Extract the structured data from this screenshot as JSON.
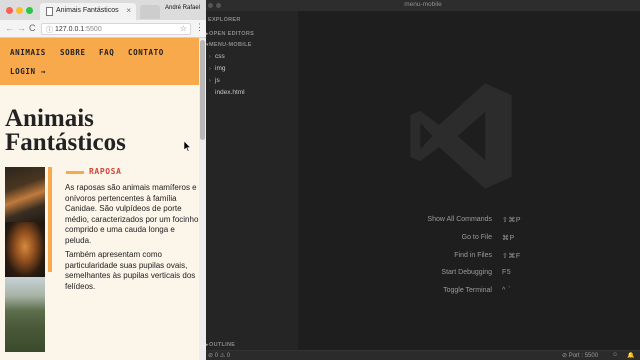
{
  "browser": {
    "tab_title": "Animais Fantásticos",
    "tab_close": "×",
    "profile_name": "André Rafael",
    "url_host": "127.0.0.1",
    "url_port": ":5500",
    "info_icon": "ⓘ",
    "back_icon": "←",
    "forward_icon": "→",
    "reload_icon": "C",
    "star_icon": "☆",
    "menu_icon": "⋮"
  },
  "site": {
    "nav": {
      "animais": "ANIMAIS",
      "sobre": "SOBRE",
      "faq": "FAQ",
      "contato": "CONTATO",
      "login": "LOGIN →"
    },
    "title": "Animais Fantásticos",
    "animal_name": "RAPOSA",
    "paragraph1": "As raposas são animais mamíferos e onívoros pertencentes à família Canidae. São vulpídeos de porte médio, caracterizados por um focinho comprido e uma cauda longa e peluda.",
    "paragraph2": "Também apresentam como particularidade suas pupilas ovais, semelhantes às pupilas verticais dos felídeos.",
    "accent_color": "#f7a94c",
    "subtitle_color": "#d0453a"
  },
  "editor": {
    "window_title": "menu-mobile",
    "sidebar": {
      "explorer": "EXPLORER",
      "open_editors": "OPEN EDITORS",
      "project": "MENU-MOBILE",
      "items": [
        "css",
        "img",
        "js",
        "index.html"
      ],
      "outline": "OUTLINE"
    },
    "shortcuts": [
      {
        "label": "Show All Commands",
        "key": "⇧⌘P"
      },
      {
        "label": "Go to File",
        "key": "⌘P"
      },
      {
        "label": "Find in Files",
        "key": "⇧⌘F"
      },
      {
        "label": "Start Debugging",
        "key": "F5"
      },
      {
        "label": "Toggle Terminal",
        "key": "^ `"
      }
    ],
    "status": {
      "problems": "⊘ 0 ⚠ 0",
      "port": "⊘ Port : 5500",
      "feedback": "☺",
      "bell": "🔔"
    }
  }
}
